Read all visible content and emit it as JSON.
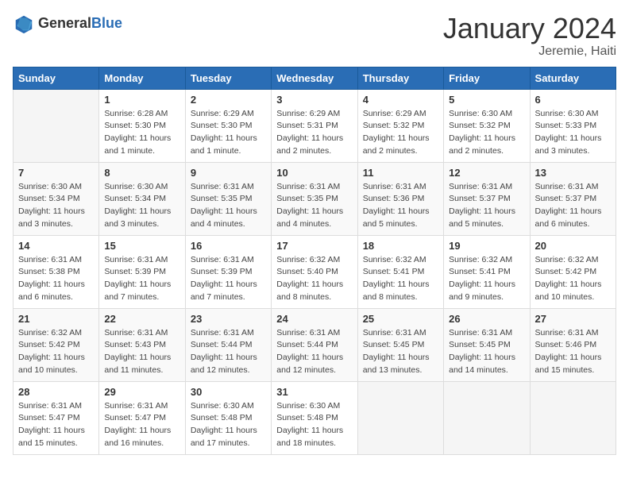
{
  "logo": {
    "general": "General",
    "blue": "Blue"
  },
  "header": {
    "title": "January 2024",
    "subtitle": "Jeremie, Haiti"
  },
  "columns": [
    "Sunday",
    "Monday",
    "Tuesday",
    "Wednesday",
    "Thursday",
    "Friday",
    "Saturday"
  ],
  "weeks": [
    [
      {
        "day": "",
        "info": ""
      },
      {
        "day": "1",
        "info": "Sunrise: 6:28 AM\nSunset: 5:30 PM\nDaylight: 11 hours\nand 1 minute."
      },
      {
        "day": "2",
        "info": "Sunrise: 6:29 AM\nSunset: 5:30 PM\nDaylight: 11 hours\nand 1 minute."
      },
      {
        "day": "3",
        "info": "Sunrise: 6:29 AM\nSunset: 5:31 PM\nDaylight: 11 hours\nand 2 minutes."
      },
      {
        "day": "4",
        "info": "Sunrise: 6:29 AM\nSunset: 5:32 PM\nDaylight: 11 hours\nand 2 minutes."
      },
      {
        "day": "5",
        "info": "Sunrise: 6:30 AM\nSunset: 5:32 PM\nDaylight: 11 hours\nand 2 minutes."
      },
      {
        "day": "6",
        "info": "Sunrise: 6:30 AM\nSunset: 5:33 PM\nDaylight: 11 hours\nand 3 minutes."
      }
    ],
    [
      {
        "day": "7",
        "info": "Sunrise: 6:30 AM\nSunset: 5:34 PM\nDaylight: 11 hours\nand 3 minutes."
      },
      {
        "day": "8",
        "info": "Sunrise: 6:30 AM\nSunset: 5:34 PM\nDaylight: 11 hours\nand 3 minutes."
      },
      {
        "day": "9",
        "info": "Sunrise: 6:31 AM\nSunset: 5:35 PM\nDaylight: 11 hours\nand 4 minutes."
      },
      {
        "day": "10",
        "info": "Sunrise: 6:31 AM\nSunset: 5:35 PM\nDaylight: 11 hours\nand 4 minutes."
      },
      {
        "day": "11",
        "info": "Sunrise: 6:31 AM\nSunset: 5:36 PM\nDaylight: 11 hours\nand 5 minutes."
      },
      {
        "day": "12",
        "info": "Sunrise: 6:31 AM\nSunset: 5:37 PM\nDaylight: 11 hours\nand 5 minutes."
      },
      {
        "day": "13",
        "info": "Sunrise: 6:31 AM\nSunset: 5:37 PM\nDaylight: 11 hours\nand 6 minutes."
      }
    ],
    [
      {
        "day": "14",
        "info": "Sunrise: 6:31 AM\nSunset: 5:38 PM\nDaylight: 11 hours\nand 6 minutes."
      },
      {
        "day": "15",
        "info": "Sunrise: 6:31 AM\nSunset: 5:39 PM\nDaylight: 11 hours\nand 7 minutes."
      },
      {
        "day": "16",
        "info": "Sunrise: 6:31 AM\nSunset: 5:39 PM\nDaylight: 11 hours\nand 7 minutes."
      },
      {
        "day": "17",
        "info": "Sunrise: 6:32 AM\nSunset: 5:40 PM\nDaylight: 11 hours\nand 8 minutes."
      },
      {
        "day": "18",
        "info": "Sunrise: 6:32 AM\nSunset: 5:41 PM\nDaylight: 11 hours\nand 8 minutes."
      },
      {
        "day": "19",
        "info": "Sunrise: 6:32 AM\nSunset: 5:41 PM\nDaylight: 11 hours\nand 9 minutes."
      },
      {
        "day": "20",
        "info": "Sunrise: 6:32 AM\nSunset: 5:42 PM\nDaylight: 11 hours\nand 10 minutes."
      }
    ],
    [
      {
        "day": "21",
        "info": "Sunrise: 6:32 AM\nSunset: 5:42 PM\nDaylight: 11 hours\nand 10 minutes."
      },
      {
        "day": "22",
        "info": "Sunrise: 6:31 AM\nSunset: 5:43 PM\nDaylight: 11 hours\nand 11 minutes."
      },
      {
        "day": "23",
        "info": "Sunrise: 6:31 AM\nSunset: 5:44 PM\nDaylight: 11 hours\nand 12 minutes."
      },
      {
        "day": "24",
        "info": "Sunrise: 6:31 AM\nSunset: 5:44 PM\nDaylight: 11 hours\nand 12 minutes."
      },
      {
        "day": "25",
        "info": "Sunrise: 6:31 AM\nSunset: 5:45 PM\nDaylight: 11 hours\nand 13 minutes."
      },
      {
        "day": "26",
        "info": "Sunrise: 6:31 AM\nSunset: 5:45 PM\nDaylight: 11 hours\nand 14 minutes."
      },
      {
        "day": "27",
        "info": "Sunrise: 6:31 AM\nSunset: 5:46 PM\nDaylight: 11 hours\nand 15 minutes."
      }
    ],
    [
      {
        "day": "28",
        "info": "Sunrise: 6:31 AM\nSunset: 5:47 PM\nDaylight: 11 hours\nand 15 minutes."
      },
      {
        "day": "29",
        "info": "Sunrise: 6:31 AM\nSunset: 5:47 PM\nDaylight: 11 hours\nand 16 minutes."
      },
      {
        "day": "30",
        "info": "Sunrise: 6:30 AM\nSunset: 5:48 PM\nDaylight: 11 hours\nand 17 minutes."
      },
      {
        "day": "31",
        "info": "Sunrise: 6:30 AM\nSunset: 5:48 PM\nDaylight: 11 hours\nand 18 minutes."
      },
      {
        "day": "",
        "info": ""
      },
      {
        "day": "",
        "info": ""
      },
      {
        "day": "",
        "info": ""
      }
    ]
  ]
}
